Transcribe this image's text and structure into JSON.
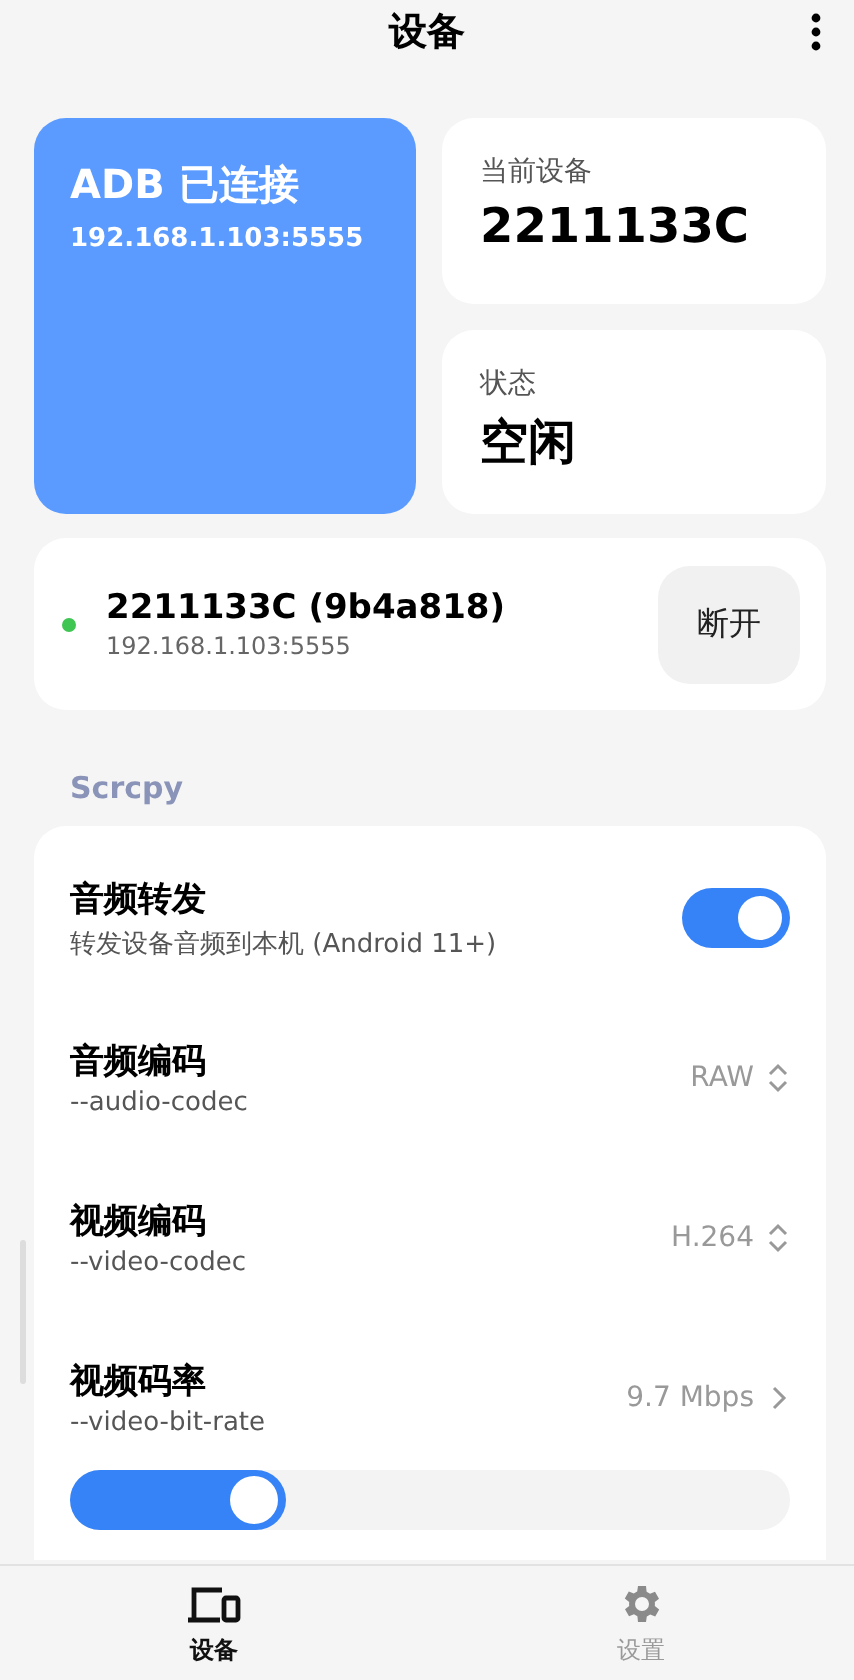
{
  "app_bar": {
    "title": "设备"
  },
  "status_card": {
    "title": "ADB 已连接",
    "address": "192.168.1.103:5555"
  },
  "info_cards": [
    {
      "label": "当前设备",
      "value": "2211133C"
    },
    {
      "label": "状态",
      "value": "空闲"
    }
  ],
  "device": {
    "name": "2211133C (9b4a818)",
    "address": "192.168.1.103:5555",
    "color": "#3fc552",
    "button": "断开"
  },
  "section": "Scrcpy",
  "settings": [
    {
      "kind": "switch",
      "title": "音频转发",
      "subtitle": "转发设备音频到本机 (Android 11+)",
      "on": true
    },
    {
      "kind": "select",
      "title": "音频编码",
      "subtitle": "--audio-codec",
      "value": "RAW"
    },
    {
      "kind": "select",
      "title": "视频编码",
      "subtitle": "--video-codec",
      "value": "H.264"
    },
    {
      "kind": "slider",
      "title": "视频码率",
      "subtitle": "--video-bit-rate",
      "value": "9.7 Mbps"
    }
  ],
  "nav": [
    {
      "kind": "devices",
      "label": "设备",
      "selected": true
    },
    {
      "kind": "settings",
      "label": "设置",
      "selected": false
    }
  ]
}
